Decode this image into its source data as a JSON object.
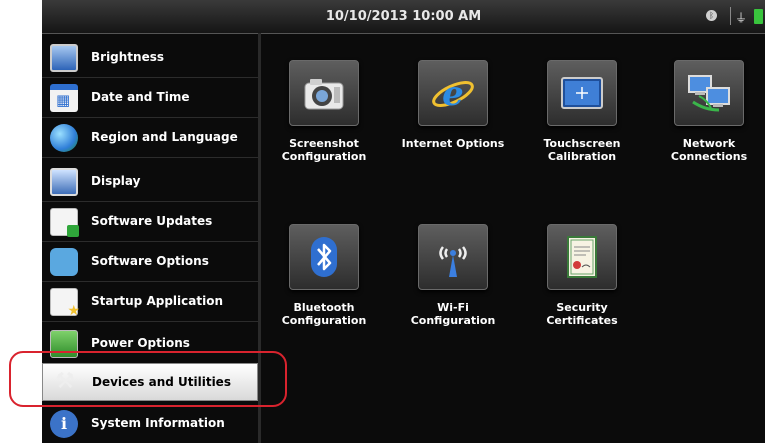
{
  "status_bar": {
    "datetime": "10/10/2013 10:00 AM",
    "icons": [
      "bluetooth-icon",
      "power-plug-icon",
      "battery-icon"
    ],
    "battery_color": "#39c43d"
  },
  "sidebar": {
    "items": [
      {
        "label": "Brightness",
        "icon": "brightness-monitor-icon",
        "selected": false
      },
      {
        "label": "Date and Time",
        "icon": "calendar-icon",
        "selected": false
      },
      {
        "label": "Region and Language",
        "icon": "globe-icon",
        "selected": false
      },
      {
        "label": "Display",
        "icon": "display-icon",
        "selected": false
      },
      {
        "label": "Software Updates",
        "icon": "software-update-icon",
        "selected": false
      },
      {
        "label": "Software Options",
        "icon": "puzzle-icon",
        "selected": false
      },
      {
        "label": "Startup Application",
        "icon": "startup-icon",
        "selected": false
      },
      {
        "label": "Power Options",
        "icon": "power-options-icon",
        "selected": false
      },
      {
        "label": "Devices and Utilities",
        "icon": "tools-icon",
        "selected": true
      },
      {
        "label": "System Information",
        "icon": "info-icon",
        "selected": false
      }
    ]
  },
  "tiles": [
    {
      "line1": "Screenshot",
      "line2": "Configuration",
      "icon": "camera-icon"
    },
    {
      "line1": "Internet Options",
      "line2": "",
      "icon": "internet-explorer-icon"
    },
    {
      "line1": "Touchscreen",
      "line2": "Calibration",
      "icon": "touchscreen-icon"
    },
    {
      "line1": "Network",
      "line2": "Connections",
      "icon": "network-icon"
    },
    {
      "line1": "Bluetooth",
      "line2": "Configuration",
      "icon": "bluetooth-icon"
    },
    {
      "line1": "Wi-Fi",
      "line2": "Configuration",
      "icon": "wifi-antenna-icon"
    },
    {
      "line1": "Security",
      "line2": "Certificates",
      "icon": "certificate-icon"
    }
  ],
  "colors": {
    "background": "#0b0b0b",
    "selected_item": "#ffffff",
    "callout": "#d9232e",
    "accent_blue": "#2e6fd0"
  }
}
